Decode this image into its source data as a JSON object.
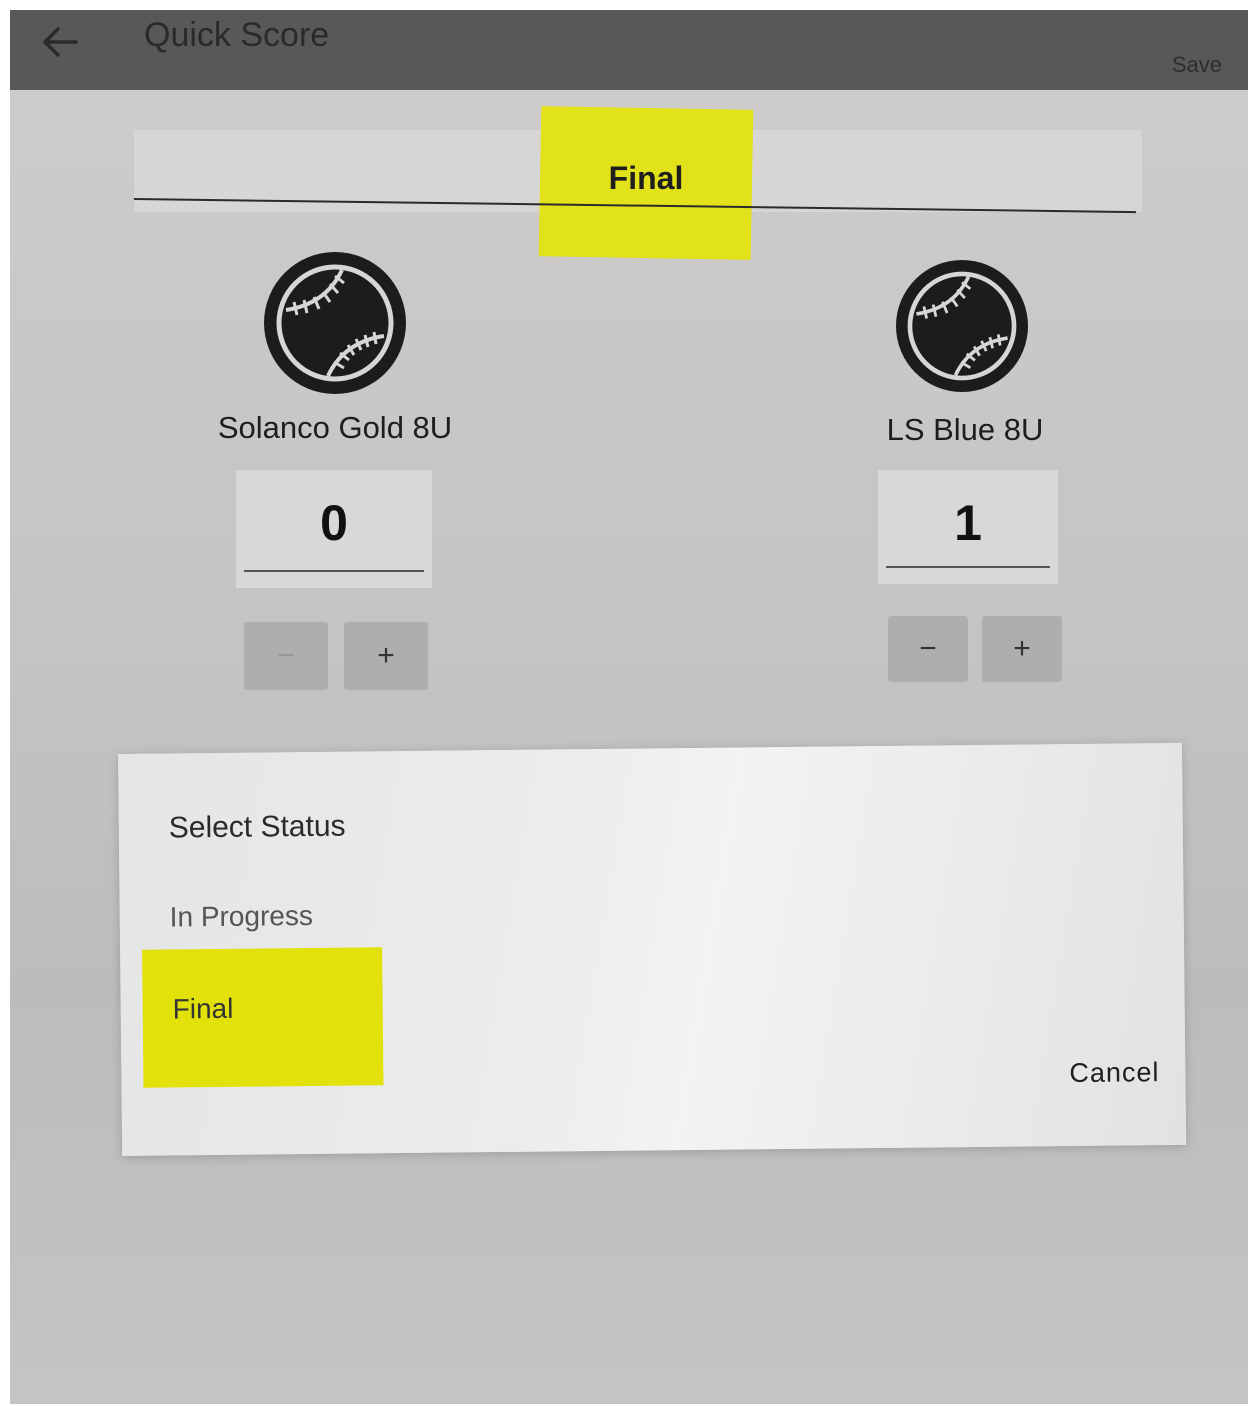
{
  "appbar": {
    "title": "Quick Score",
    "save_label": "Save",
    "back_icon": "arrow-left-icon"
  },
  "status_field": {
    "value": "Final"
  },
  "teams": [
    {
      "name": "Solanco Gold 8U",
      "score": "0",
      "decrement_label": "−",
      "increment_label": "+",
      "icon": "baseball-icon"
    },
    {
      "name": "LS Blue 8U",
      "score": "1",
      "decrement_label": "−",
      "increment_label": "+",
      "icon": "baseball-icon"
    }
  ],
  "dialog": {
    "title": "Select Status",
    "options": [
      "In Progress",
      "Final"
    ],
    "cancel_label": "Cancel"
  },
  "colors": {
    "highlight": "#e2e21a",
    "appbar": "#5a5856"
  }
}
